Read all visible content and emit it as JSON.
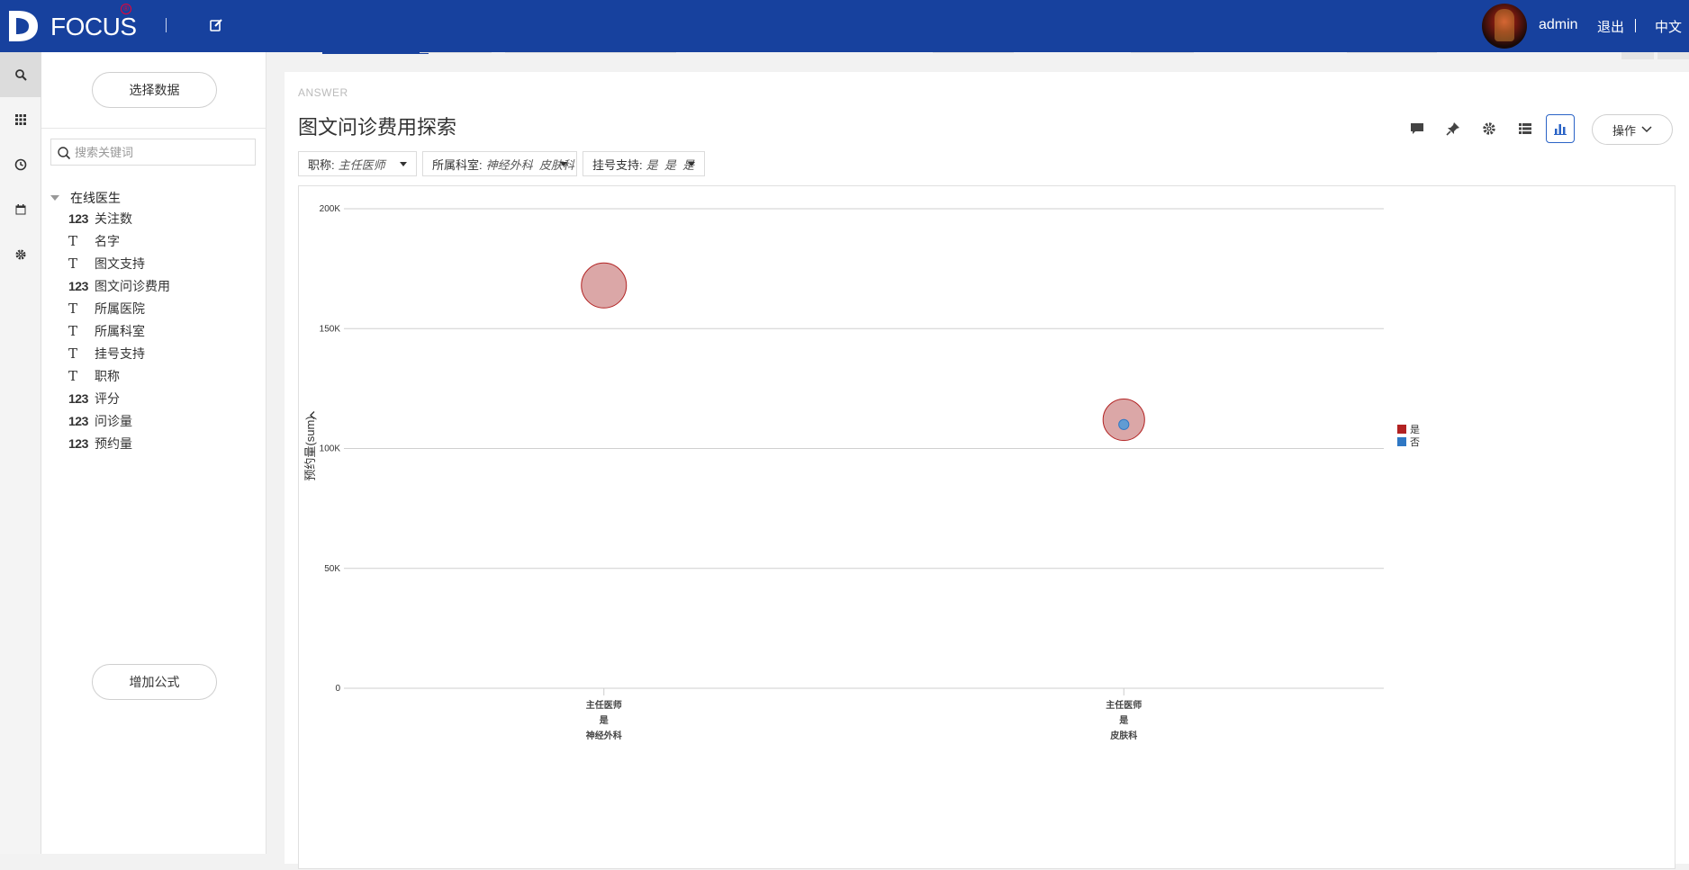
{
  "app": {
    "logo_text": "FOCUS",
    "logo_reg": "®",
    "user_name": "admin",
    "logout_label": "退出",
    "language_label": "中文"
  },
  "rail": {
    "items": [
      {
        "icon": "search-icon",
        "active": true
      },
      {
        "icon": "grid-icon",
        "active": false
      },
      {
        "icon": "clock-icon",
        "active": false
      },
      {
        "icon": "calendar-icon",
        "active": false
      },
      {
        "icon": "gear-icon",
        "active": false
      }
    ]
  },
  "datapanel": {
    "select_data_label": "选择数据",
    "search_placeholder": "搜索关键词",
    "table_name": "在线医生",
    "fields": [
      {
        "type": "123",
        "name": "关注数"
      },
      {
        "type": "T",
        "name": "名字"
      },
      {
        "type": "T",
        "name": "图文支持"
      },
      {
        "type": "123",
        "name": "图文问诊费用"
      },
      {
        "type": "T",
        "name": "所属医院"
      },
      {
        "type": "T",
        "name": "所属科室"
      },
      {
        "type": "T",
        "name": "挂号支持"
      },
      {
        "type": "T",
        "name": "职称"
      },
      {
        "type": "123",
        "name": "评分"
      },
      {
        "type": "123",
        "name": "问诊量"
      },
      {
        "type": "123",
        "name": "预约量"
      }
    ],
    "add_formula_label": "增加公式"
  },
  "answer": {
    "section_label": "ANSWER",
    "title": "图文问诊费用探索",
    "ops_label": "操作",
    "filters": [
      {
        "key": "职称:",
        "value": "主任医师"
      },
      {
        "key": "所属科室:",
        "value": "神经外科  皮肤科"
      },
      {
        "key": "挂号支持:",
        "value": "是  是  是"
      }
    ],
    "toolbar_icons": [
      "comment-icon",
      "pin-icon",
      "gear-icon",
      "list-icon",
      "bar-chart-icon"
    ]
  },
  "chart_data": {
    "type": "scatter",
    "ylabel": "预约量(sum)",
    "ylim": [
      0,
      200000
    ],
    "yticks": [
      {
        "value": 0,
        "label": "0"
      },
      {
        "value": 50000,
        "label": "50K"
      },
      {
        "value": 100000,
        "label": "100K"
      },
      {
        "value": 150000,
        "label": "150K"
      },
      {
        "value": 200000,
        "label": "200K"
      }
    ],
    "categories": [
      [
        "主任医师",
        "是",
        "神经外科"
      ],
      [
        "主任医师",
        "是",
        "皮肤科"
      ]
    ],
    "series": [
      {
        "name": "是",
        "color": "#b22222",
        "fill": "#d9a2a2",
        "points": [
          {
            "category_index": 0,
            "y": 168000,
            "size": 1.0
          },
          {
            "category_index": 1,
            "y": 112000,
            "size": 0.85
          }
        ]
      },
      {
        "name": "否",
        "color": "#2f78c4",
        "fill": "#5b9bd5",
        "points": [
          {
            "category_index": 1,
            "y": 110000,
            "size": 0.05
          }
        ]
      }
    ],
    "grid": true,
    "legend_position": "right"
  }
}
